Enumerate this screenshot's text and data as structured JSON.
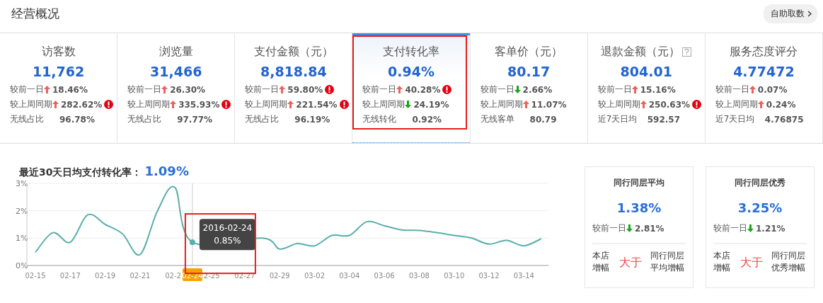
{
  "header": {
    "title": "经营概况",
    "button": "自助取数"
  },
  "metrics": [
    {
      "title": "访客数",
      "value": "11,762",
      "selected": false,
      "help": false,
      "rows": [
        {
          "label": "较前一日",
          "kind": "up",
          "value": "18.46%",
          "alert": false
        },
        {
          "label": "较上周同期",
          "kind": "up",
          "value": "282.62%",
          "alert": true
        },
        {
          "label": "无线占比",
          "kind": "plain",
          "value": "96.78%",
          "alert": false
        }
      ]
    },
    {
      "title": "浏览量",
      "value": "31,466",
      "selected": false,
      "help": false,
      "rows": [
        {
          "label": "较前一日",
          "kind": "up",
          "value": "26.30%",
          "alert": false
        },
        {
          "label": "较上周同期",
          "kind": "up",
          "value": "335.93%",
          "alert": true
        },
        {
          "label": "无线占比",
          "kind": "plain",
          "value": "97.77%",
          "alert": false
        }
      ]
    },
    {
      "title": "支付金额（元）",
      "value": "8,818.84",
      "selected": false,
      "help": false,
      "rows": [
        {
          "label": "较前一日",
          "kind": "up",
          "value": "59.80%",
          "alert": true
        },
        {
          "label": "较上周同期",
          "kind": "up",
          "value": "221.54%",
          "alert": true
        },
        {
          "label": "无线占比",
          "kind": "plain",
          "value": "96.19%",
          "alert": false
        }
      ]
    },
    {
      "title": "支付转化率",
      "value": "0.94%",
      "selected": true,
      "help": false,
      "rows": [
        {
          "label": "较前一日",
          "kind": "up",
          "value": "40.28%",
          "alert": true
        },
        {
          "label": "较上周同期",
          "kind": "down",
          "value": "24.19%",
          "alert": false
        },
        {
          "label": "无线转化",
          "kind": "plain",
          "value": "0.92%",
          "alert": false
        }
      ]
    },
    {
      "title": "客单价（元）",
      "value": "80.17",
      "selected": false,
      "help": false,
      "rows": [
        {
          "label": "较前一日",
          "kind": "down",
          "value": "2.66%",
          "alert": false
        },
        {
          "label": "较上周同期",
          "kind": "up",
          "value": "11.07%",
          "alert": false
        },
        {
          "label": "无线客单",
          "kind": "plain",
          "value": "80.79",
          "alert": false
        }
      ]
    },
    {
      "title": "退款金额（元）",
      "value": "804.01",
      "selected": false,
      "help": true,
      "rows": [
        {
          "label": "较前一日",
          "kind": "up",
          "value": "15.16%",
          "alert": false
        },
        {
          "label": "较上周同期",
          "kind": "up",
          "value": "250.63%",
          "alert": true
        },
        {
          "label": "近7天日均",
          "kind": "plain",
          "value": "592.57",
          "alert": false
        }
      ]
    },
    {
      "title": "服务态度评分",
      "value": "4.77472",
      "selected": false,
      "help": false,
      "rows": [
        {
          "label": "较前一日",
          "kind": "up",
          "value": "0.07%",
          "alert": false
        },
        {
          "label": "较上周同期",
          "kind": "up",
          "value": "0.24%",
          "alert": false
        },
        {
          "label": "近7天日均",
          "kind": "plain",
          "value": "4.76875",
          "alert": false
        }
      ]
    }
  ],
  "chart_section": {
    "title": "最近30天日均支付转化率：",
    "average": "1.09%",
    "chart_data": {
      "type": "line",
      "categories": [
        "02-15",
        null,
        "02-17",
        null,
        "02-19",
        null,
        "02-21",
        null,
        "02-2",
        "02-24",
        "2-25",
        null,
        "02-27",
        null,
        "02-29",
        null,
        "03-02",
        null,
        "03-04",
        null,
        "03-06",
        null,
        "03-08",
        null,
        "03-10",
        null,
        "03-12",
        null,
        "03-14",
        null
      ],
      "series": [
        {
          "color": "#5aafac",
          "values": [
            0.48,
            1.2,
            0.85,
            1.85,
            1.5,
            1.15,
            0.4,
            2.0,
            2.85,
            0.85,
            null,
            null,
            null,
            1.0,
            0.6,
            0.8,
            0.72,
            1.1,
            1.1,
            1.6,
            1.45,
            1.3,
            1.28,
            1.2,
            1.1,
            1.0,
            0.78,
            0.92,
            0.72,
            0.98
          ]
        }
      ],
      "ylim": [
        0,
        3
      ],
      "yticks": [
        {
          "value": 0,
          "label": "0%"
        },
        {
          "value": 1,
          "label": "1%"
        },
        {
          "value": 2,
          "label": "2%"
        },
        {
          "value": 3,
          "label": "3%"
        }
      ],
      "ref_lines": [
        {
          "axis": "x",
          "value": "02-24"
        }
      ],
      "annotations": [
        {
          "x": "02-24",
          "y": 0.85,
          "text": "2016-02-24"
        },
        {
          "x": "02-24",
          "y": 0.85,
          "text": "0.85%"
        }
      ]
    }
  },
  "benchmarks": [
    {
      "title": "同行同层平均",
      "value": "1.38%",
      "compare_label": "较前一日",
      "kind": "down",
      "compare_value": "2.81%",
      "left": "本店增幅",
      "relation": "大于",
      "right": "同行同层平均增幅"
    },
    {
      "title": "同行同层优秀",
      "value": "3.25%",
      "compare_label": "较前一日",
      "kind": "down",
      "compare_value": "1.21%",
      "left": "本店增幅",
      "relation": "大于",
      "right": "同行同层优秀增幅"
    }
  ]
}
